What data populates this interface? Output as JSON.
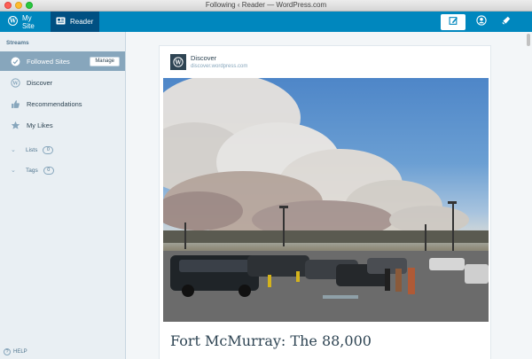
{
  "window": {
    "title": "Following ‹ Reader — WordPress.com"
  },
  "masterbar": {
    "my_site_label": "My Site",
    "reader_label": "Reader",
    "accent": "#0087be",
    "icons": [
      "wordpress-icon",
      "reader-icon",
      "write-icon",
      "me-icon",
      "notifications-icon"
    ]
  },
  "sidebar": {
    "heading": "Streams",
    "items": [
      {
        "label": "Followed Sites",
        "icon": "check-circle-icon",
        "action": "Manage"
      },
      {
        "label": "Discover",
        "icon": "wordpress-icon"
      },
      {
        "label": "Recommendations",
        "icon": "thumbs-up-icon"
      },
      {
        "label": "My Likes",
        "icon": "star-icon"
      }
    ],
    "lists": {
      "label": "Lists",
      "count": "0"
    },
    "tags": {
      "label": "Tags",
      "count": "0"
    },
    "help": "HELP"
  },
  "post": {
    "site_name": "Discover",
    "site_url": "discover.wordpress.com",
    "title": "Fort McMurray: The 88,000"
  }
}
